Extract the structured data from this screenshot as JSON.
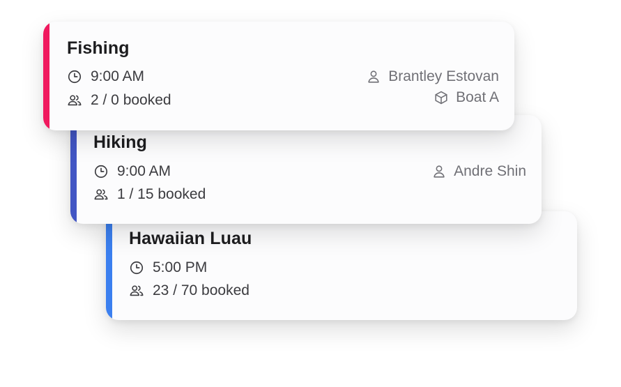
{
  "cards": [
    {
      "title": "Fishing",
      "time": "9:00 AM",
      "booked": "2 / 0 booked",
      "guide": "Brantley Estovan",
      "resource": "Boat A",
      "accent_color": "#f0195e"
    },
    {
      "title": "Hiking",
      "time": "9:00 AM",
      "booked": "1 / 15 booked",
      "guide": "Andre Shin",
      "accent_color": "#4256c4"
    },
    {
      "title": "Hawaiian Luau",
      "time": "5:00 PM",
      "booked": "23 / 70 booked",
      "accent_color": "#3b7fef"
    }
  ],
  "icons": {
    "time": "clock-icon",
    "booked": "people-icon",
    "guide": "person-icon",
    "resource": "box-icon"
  }
}
